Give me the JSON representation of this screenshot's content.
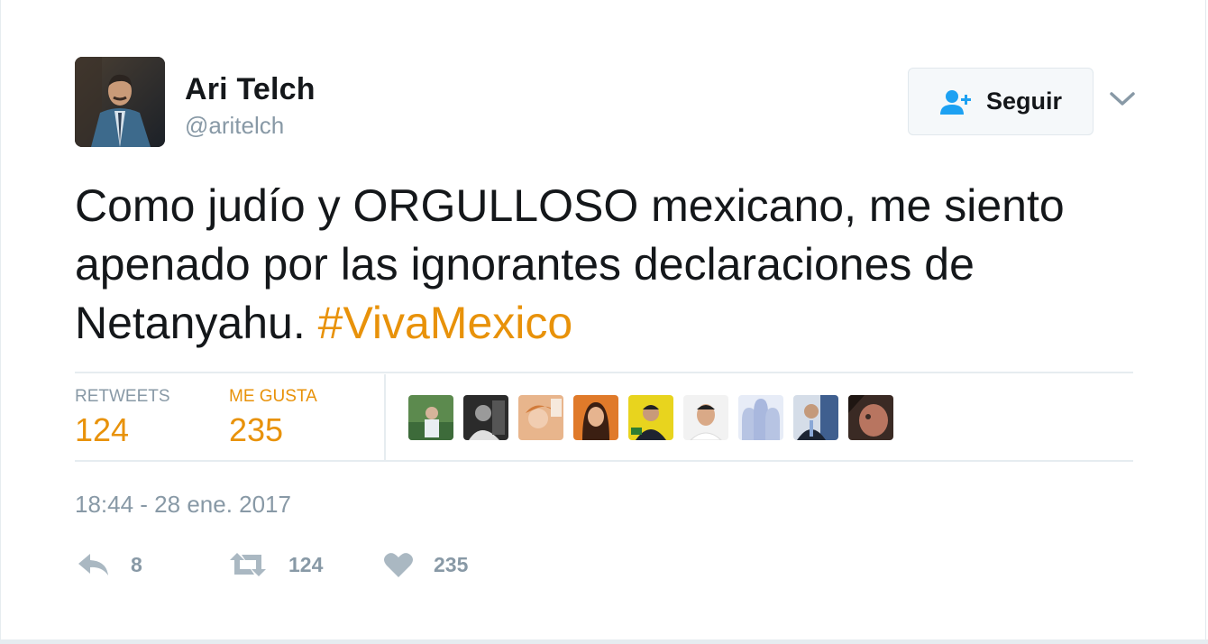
{
  "author": {
    "name": "Ari Telch",
    "handle": "@aritelch"
  },
  "follow_button": {
    "label": "Seguir",
    "icon": "add-user-icon"
  },
  "menu_caret_icon": "chevron-down-icon",
  "tweet": {
    "text": "Como judío y ORGULLOSO mexicano, me siento apenado por las ignorantes declaraciones de Netanyahu. ",
    "hashtag": "#VivaMexico"
  },
  "stats": {
    "retweets_label": "RETWEETS",
    "retweets_value": "124",
    "likes_label": "ME GUSTA",
    "likes_value": "235"
  },
  "likers_count_shown": 9,
  "timestamp": "18:44 - 28 ene. 2017",
  "actions": {
    "reply_count": "8",
    "retweet_count": "124",
    "like_count": "235"
  },
  "colors": {
    "accent": "#e8920a",
    "follow_icon": "#1da1f2",
    "muted": "#8899a6",
    "text": "#14171a"
  }
}
